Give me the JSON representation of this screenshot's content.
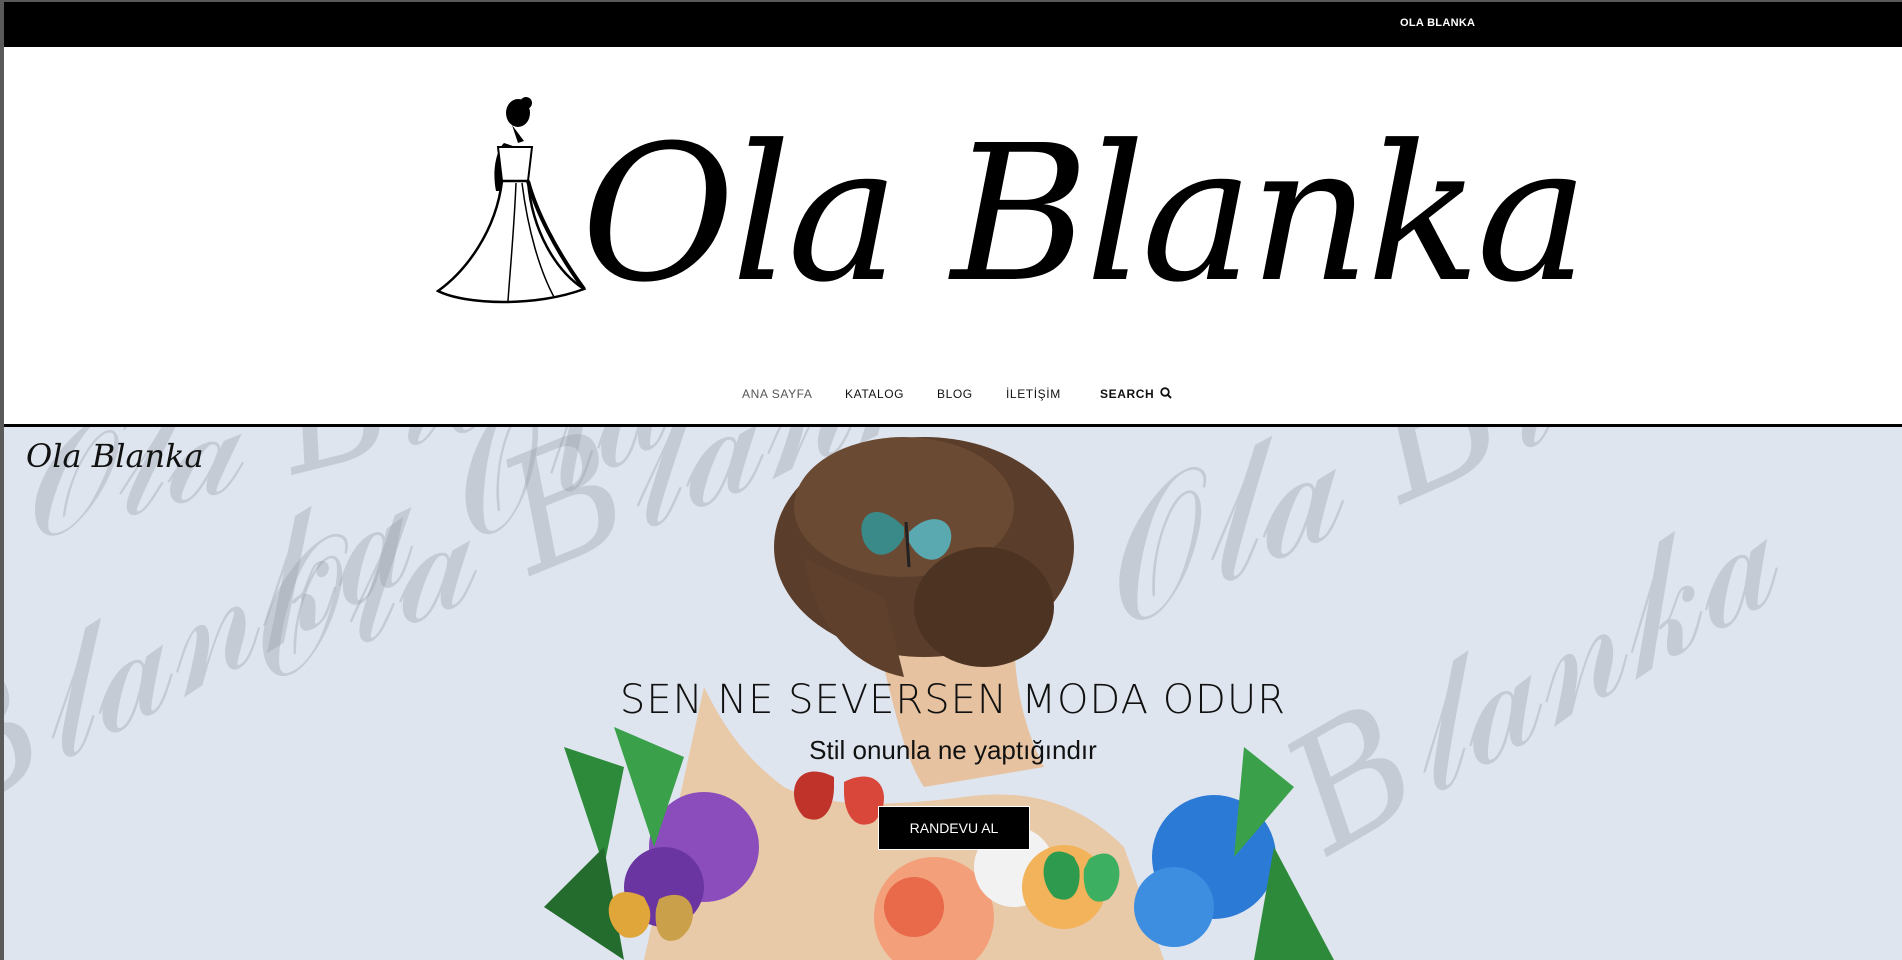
{
  "topbar": {
    "brand": "OLA BLANKA"
  },
  "logo": {
    "text": "Ola Blanka"
  },
  "nav": {
    "items": [
      {
        "label": "ANA SAYFA",
        "active": true
      },
      {
        "label": "KATALOG"
      },
      {
        "label": "BLOG"
      },
      {
        "label": "İLETİŞİM"
      }
    ],
    "search_label": "SEARCH",
    "search_icon": "search-icon"
  },
  "hero": {
    "corner_logo": "Ola Blanka",
    "title": "SEN NE SEVERSEN MODA ODUR",
    "subtitle": "Stil onunla ne yaptığındır",
    "cta_label": "RANDEVU AL",
    "background_color": "#dfe5ef"
  }
}
